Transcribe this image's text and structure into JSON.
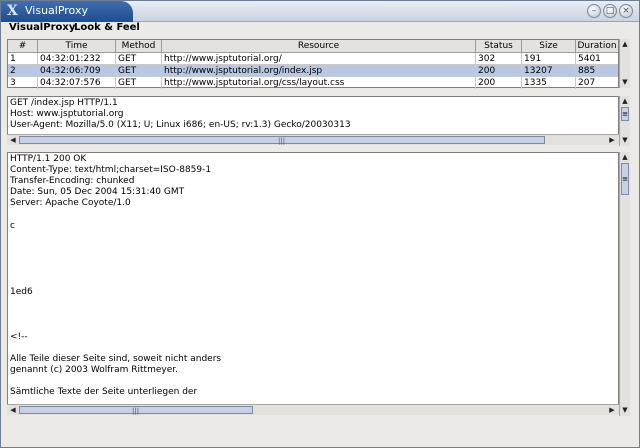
{
  "window": {
    "title": "VisualProxy",
    "app_icon": "x-logo-icon",
    "controls": [
      "minimize-icon",
      "maximize-icon",
      "close-icon"
    ]
  },
  "menu": [
    "VisualProxy",
    "Look & Feel"
  ],
  "table": {
    "columns": [
      "#",
      "Time",
      "Method",
      "Resource",
      "Status",
      "Size",
      "Duration"
    ],
    "rows": [
      [
        "1",
        "04:32:01:232",
        "GET",
        "http://www.jsptutorial.org/",
        "302",
        "191",
        "5401"
      ],
      [
        "2",
        "04:32:06:709",
        "GET",
        "http://www.jsptutorial.org/index.jsp",
        "200",
        "13207",
        "885"
      ],
      [
        "3",
        "04:32:07:576",
        "GET",
        "http://www.jsptutorial.org/css/layout.css",
        "200",
        "1335",
        "207"
      ]
    ],
    "selected_row": 2
  },
  "request": {
    "text": "GET /index.jsp HTTP/1.1\nHost: www.jsptutorial.org\nUser-Agent: Mozilla/5.0 (X11; U; Linux i686; en-US; rv:1.3) Gecko/20030313"
  },
  "response": {
    "text": "HTTP/1.1 200 OK\nContent-Type: text/html;charset=ISO-8859-1\nTransfer-Encoding: chunked\nDate: Sun, 05 Dec 2004 15:31:40 GMT\nServer: Apache Coyote/1.0\n\nc\n\n\n\n\n\n1ed6\n\n\n\n<!--\n\nAlle Teile dieser Seite sind, soweit nicht anders\ngenannt (c) 2003 Wolfram Rittmeyer.\n\nSämtliche Texte der Seite unterliegen der"
  },
  "scroll_glyphs": {
    "up": "▲",
    "down": "▼",
    "left": "◀",
    "right": "▶",
    "grip": "|||",
    "grip_v": "≡"
  }
}
